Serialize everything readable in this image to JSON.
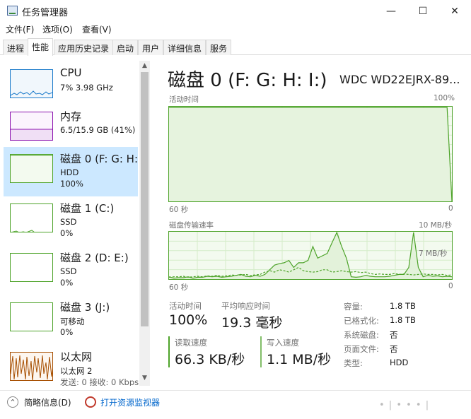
{
  "window": {
    "title": "任务管理器"
  },
  "window_controls": {
    "minimize": "—",
    "maximize": "☐",
    "close": "✕"
  },
  "menu": [
    "文件(F)",
    "选项(O)",
    "查看(V)"
  ],
  "tabs": [
    "进程",
    "性能",
    "应用历史记录",
    "启动",
    "用户",
    "详细信息",
    "服务"
  ],
  "active_tab": "性能",
  "sidebar": {
    "items": [
      {
        "name": "CPU",
        "sub1": "7%  3.98 GHz",
        "sub2": "",
        "sub3": "",
        "color": "#1979ca"
      },
      {
        "name": "内存",
        "sub1": "6.5/15.9 GB (41%)",
        "sub2": "",
        "sub3": "",
        "color": "#8b12ae"
      },
      {
        "name": "磁盘 0 (F: G: H:",
        "sub1": "HDD",
        "sub2": "100%",
        "sub3": "",
        "color": "#4da329"
      },
      {
        "name": "磁盘 1 (C:)",
        "sub1": "SSD",
        "sub2": "0%",
        "sub3": "",
        "color": "#4da329"
      },
      {
        "name": "磁盘 2 (D: E:)",
        "sub1": "SSD",
        "sub2": "0%",
        "sub3": "",
        "color": "#4da329"
      },
      {
        "name": "磁盘 3 (J:)",
        "sub1": "可移动",
        "sub2": "0%",
        "sub3": "",
        "color": "#4da329"
      },
      {
        "name": "以太网",
        "sub1": "以太网 2",
        "sub2": "发送: 0  接收: 0 Kbps",
        "sub3": "",
        "color": "#a74f01"
      }
    ],
    "selected_index": 2,
    "scroll_up": "▲",
    "scroll_down": "▼"
  },
  "main": {
    "title": "磁盘 0 (F: G: H: I:)",
    "model": "WDC WD22EJRX-89...",
    "active_time_label": "活动时间",
    "active_time_max": "100%",
    "graph1_x_left": "60 秒",
    "graph1_x_right": "0",
    "transfer_label": "磁盘传输速率",
    "transfer_max": "10 MB/秒",
    "transfer_mid": "7 MB/秒",
    "graph2_x_left": "60 秒",
    "graph2_x_right": "0"
  },
  "stats": {
    "active_time": {
      "label": "活动时间",
      "value": "100%"
    },
    "avg_response": {
      "label": "平均响应时间",
      "value": "19.3 毫秒"
    },
    "read_speed": {
      "label": "读取速度",
      "value": "66.3 KB/秒"
    },
    "write_speed": {
      "label": "写入速度",
      "value": "1.1 MB/秒"
    }
  },
  "info": [
    {
      "label": "容量:",
      "value": "1.8 TB"
    },
    {
      "label": "已格式化:",
      "value": "1.8 TB"
    },
    {
      "label": "系统磁盘:",
      "value": "否"
    },
    {
      "label": "页面文件:",
      "value": "否"
    },
    {
      "label": "类型:",
      "value": "HDD"
    }
  ],
  "bottom": {
    "brief_info": "简略信息(D)",
    "open_monitor": "打开资源监视器",
    "expand_icon": "⌃"
  },
  "watermark": "• |  • • •  |",
  "colors": {
    "disk": "#4da329",
    "cpu": "#1979ca",
    "memory": "#8b12ae",
    "ethernet": "#a74f01",
    "selected": "#cce8ff"
  },
  "series": {
    "active_time": [
      100,
      100,
      100,
      100,
      100,
      100,
      100,
      100,
      100,
      100,
      100,
      100,
      100,
      100,
      100,
      100,
      100,
      100,
      100,
      100,
      100,
      100,
      100,
      100,
      100,
      100,
      100,
      100,
      100,
      100,
      100,
      100,
      100,
      100,
      100,
      100,
      100,
      100,
      100,
      100,
      100,
      100,
      100,
      100,
      100,
      100,
      100,
      100,
      100,
      100,
      100,
      100,
      100,
      100,
      100,
      100,
      100,
      100,
      100,
      0
    ],
    "transfer_read": [
      0.5,
      0.2,
      0.3,
      0.3,
      0.5,
      0.2,
      0.4,
      0.4,
      0.6,
      0.5,
      0.6,
      0.4,
      0.5,
      0.6,
      0.8,
      1.0,
      0.6,
      0.5,
      0.8,
      0.6,
      1.0,
      2.0,
      3.0,
      3.3,
      3.5,
      4.0,
      2.5,
      3.5,
      3.5,
      4.0,
      7.0,
      4.5,
      5.0,
      5.5,
      7.8,
      10.0,
      7.0,
      4.5,
      0.5,
      0.4,
      0.5,
      0.8,
      0.6,
      0.5,
      0.5,
      0.5,
      0.6,
      0.8,
      1.0,
      1.0,
      2.5,
      10.0,
      2.5,
      0.5,
      0.8,
      0.6,
      0.7,
      0.5,
      0.6,
      0.5
    ],
    "transfer_write": [
      0.4,
      0.5,
      0.5,
      0.6,
      0.4,
      0.5,
      0.6,
      0.5,
      0.7,
      0.6,
      0.8,
      0.6,
      0.7,
      0.9,
      0.8,
      0.9,
      1.0,
      0.8,
      0.9,
      1.0,
      1.5,
      1.8,
      1.5,
      2.0,
      1.8,
      1.5,
      2.0,
      2.5,
      1.8,
      1.6,
      1.5,
      1.6,
      2.0,
      2.0,
      1.5,
      1.6,
      1.8,
      1.6,
      1.5,
      1.6,
      1.4,
      1.5,
      1.2,
      1.0,
      1.1,
      1.0,
      1.0,
      1.2,
      1.0,
      1.1,
      1.0,
      0.9,
      1.0,
      1.1,
      1.0,
      1.0,
      0.9,
      1.0,
      0.8,
      0.9
    ]
  }
}
